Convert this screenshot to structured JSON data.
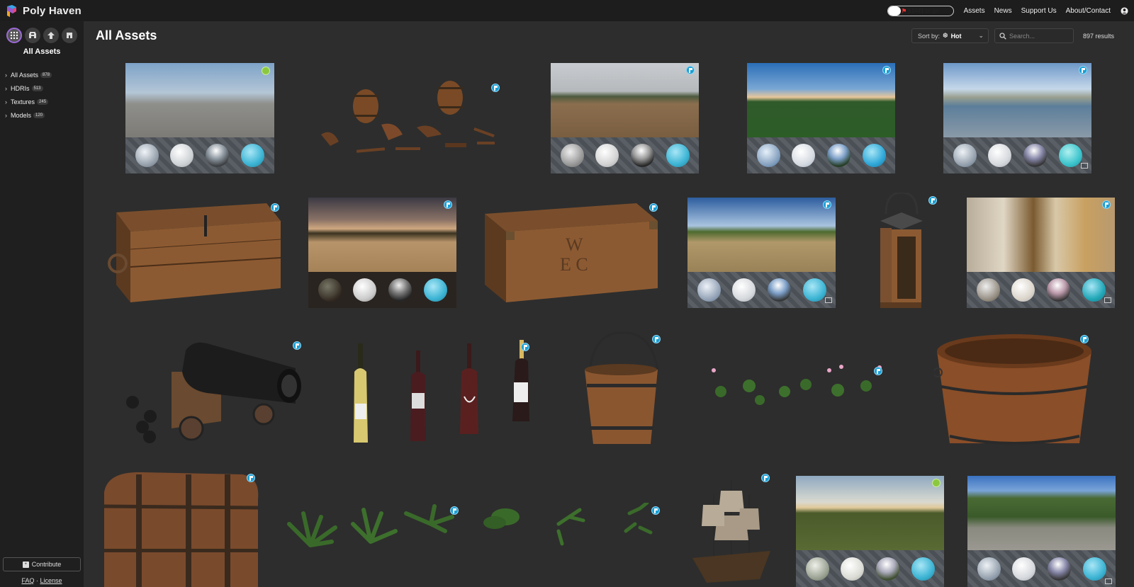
{
  "app": {
    "name": "Poly Haven"
  },
  "header": {
    "progress": {
      "label": "$1441 to go",
      "fraction": 0.2
    },
    "nav": [
      "Assets",
      "News",
      "Support Us",
      "About/Contact"
    ]
  },
  "sidebar": {
    "title": "All Assets",
    "type_icons": [
      "all-assets-icon",
      "hdri-icon",
      "texture-icon",
      "model-icon"
    ],
    "categories": [
      {
        "label": "All Assets",
        "count": "878"
      },
      {
        "label": "HDRIs",
        "count": "513"
      },
      {
        "label": "Textures",
        "count": "245"
      },
      {
        "label": "Models",
        "count": "120"
      }
    ],
    "contribute": "Contribute",
    "footer": {
      "faq": "FAQ",
      "separator": "·",
      "license": "License"
    }
  },
  "main": {
    "title": "All Assets",
    "sort": {
      "label": "Sort by:",
      "value": "Hot"
    },
    "search": {
      "placeholder": "Search..."
    },
    "results": "897 results"
  },
  "colors": {
    "accent": "#9c6ad8",
    "badge_blue": "#1a9fd4",
    "badge_new": "#8cc83f",
    "background": "#2d2d2d",
    "sidebar": "#1f1f1f"
  }
}
